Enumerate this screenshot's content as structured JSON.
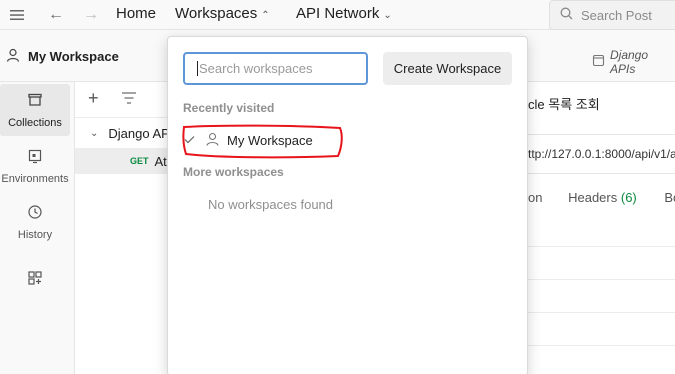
{
  "topbar": {
    "home_label": "Home",
    "workspaces_label": "Workspaces",
    "api_network_label": "API Network",
    "search_placeholder": "Search Post"
  },
  "workspace_header": {
    "title": "My Workspace",
    "open_tab_label": "Django APIs"
  },
  "sidebar": {
    "items": [
      {
        "label": "Collections",
        "icon": "collections-icon",
        "active": true
      },
      {
        "label": "Environments",
        "icon": "environments-icon",
        "active": false
      },
      {
        "label": "History",
        "icon": "history-icon",
        "active": false
      },
      {
        "label": "",
        "icon": "add-widget-icon",
        "active": false
      }
    ]
  },
  "collections": {
    "items": [
      {
        "label": "Django AP"
      },
      {
        "method": "GET",
        "label": "Ati"
      }
    ]
  },
  "main": {
    "request_title": "cle 목록 조회",
    "url": "ttp://127.0.0.1:8000/api/v1/a",
    "tab_partial": "on",
    "headers_label": "Headers",
    "headers_count": "(6)",
    "next_tab_partial": "Bo"
  },
  "popup": {
    "search_placeholder": "Search workspaces",
    "create_button": "Create Workspace",
    "recently_visited_label": "Recently visited",
    "recent_workspace": "My Workspace",
    "more_label": "More workspaces",
    "empty_message": "No workspaces found"
  },
  "colors": {
    "accent_focus": "#5f96d8",
    "annotation": "#e8141b",
    "method_get": "#0b8a3e"
  }
}
